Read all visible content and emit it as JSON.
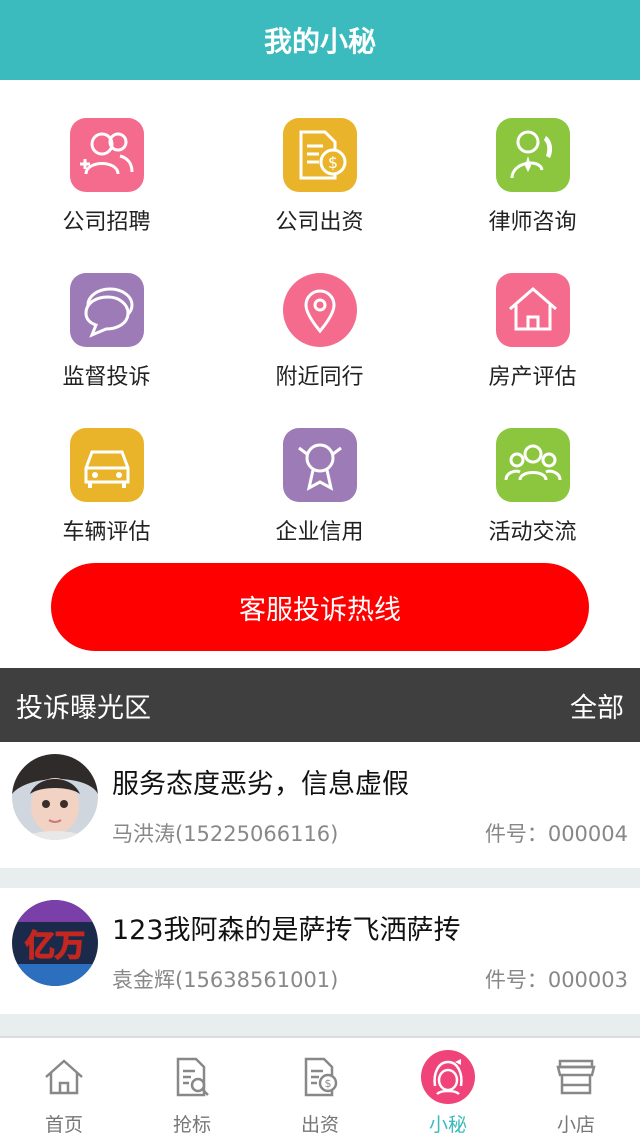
{
  "header": {
    "title": "我的小秘"
  },
  "grid": {
    "items": [
      {
        "label": "公司招聘",
        "icon": "people-add-icon",
        "color": "#f56b8d"
      },
      {
        "label": "公司出资",
        "icon": "document-money-icon",
        "color": "#eab42a"
      },
      {
        "label": "律师咨询",
        "icon": "lawyer-phone-icon",
        "color": "#8cc63f"
      },
      {
        "label": "监督投诉",
        "icon": "chat-bubbles-icon",
        "color": "#9d7bb6"
      },
      {
        "label": "附近同行",
        "icon": "location-pin-icon",
        "color": "#f56b8d"
      },
      {
        "label": "房产评估",
        "icon": "house-icon",
        "color": "#f56b8d"
      },
      {
        "label": "车辆评估",
        "icon": "car-icon",
        "color": "#eab42a"
      },
      {
        "label": "企业信用",
        "icon": "badge-ribbon-icon",
        "color": "#9d7bb6"
      },
      {
        "label": "活动交流",
        "icon": "group-icon",
        "color": "#8cc63f"
      }
    ]
  },
  "hotline": {
    "label": "客服投诉热线",
    "color": "#ff0000"
  },
  "section": {
    "title": "投诉曝光区",
    "more": "全部"
  },
  "complaints": [
    {
      "title": "服务态度恶劣，信息虚假",
      "person": "马洪涛(15225066116)",
      "number": "件号：000004"
    },
    {
      "title": "123我阿森的是萨抟飞洒萨抟",
      "person": "袁金辉(15638561001)",
      "number": "件号：000003",
      "avatar_text": "亿万"
    }
  ],
  "tabbar": {
    "items": [
      {
        "label": "首页",
        "icon": "home-icon"
      },
      {
        "label": "抢标",
        "icon": "document-search-icon"
      },
      {
        "label": "出资",
        "icon": "document-money-icon"
      },
      {
        "label": "小秘",
        "icon": "girl-avatar-icon",
        "active": true
      },
      {
        "label": "小店",
        "icon": "shop-icon"
      }
    ]
  },
  "theme": {
    "primary": "#3bbbbd",
    "dark_bar": "#3f3f3f"
  }
}
